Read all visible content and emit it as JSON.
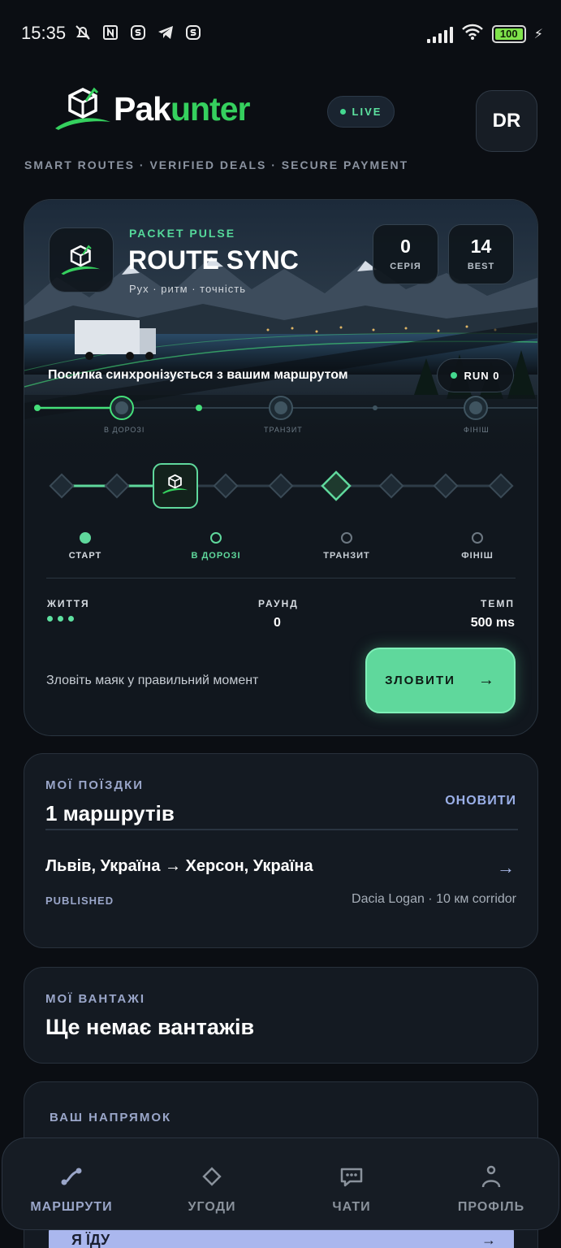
{
  "status_bar": {
    "time": "15:35",
    "battery": "100"
  },
  "header": {
    "brand_part1": "Pak",
    "brand_part2": "unter",
    "live_label": "LIVE",
    "avatar_initials": "DR",
    "tagline": "SMART ROUTES · VERIFIED DEALS · SECURE PAYMENT"
  },
  "game": {
    "kicker": "PACKET PULSE",
    "title": "ROUTE SYNC",
    "subtitle": "Рух · ритм · точність",
    "series_value": "0",
    "series_label": "СЕРІЯ",
    "best_value": "14",
    "best_label": "BEST",
    "sync_text": "Посилка синхронізується з вашим маршрутом",
    "run_label": "RUN 0",
    "scene_labels": [
      "В ДОРОЗІ",
      "ТРАНЗИТ",
      "ФІНІШ"
    ],
    "stages": [
      {
        "label": "СТАРТ",
        "state": "done"
      },
      {
        "label": "В ДОРОЗІ",
        "state": "active"
      },
      {
        "label": "ТРАНЗИТ",
        "state": "pending"
      },
      {
        "label": "ФІНІШ",
        "state": "pending"
      }
    ],
    "lives_label": "ЖИТТЯ",
    "lives_count": 3,
    "round_label": "РАУНД",
    "round_value": "0",
    "tempo_label": "ТЕМП",
    "tempo_value": "500 ms",
    "hint": "Зловіть маяк у правильний момент",
    "catch_label": "ЗЛОВИТИ",
    "catch_arrow": "→",
    "colors": {
      "accent": "#5fd89c",
      "accent_dark": "#35d05e"
    }
  },
  "trips": {
    "label": "МОЇ ПОЇЗДКИ",
    "title": "1 маршрутів",
    "refresh_label": "ОНОВИТИ",
    "items": [
      {
        "route": "Львів, Україна → Херсон, Україна",
        "status": "PUBLISHED",
        "vehicle": "Dacia Logan · 10 км corridor",
        "arrow": "→"
      }
    ]
  },
  "cargo": {
    "label": "МОЇ ВАНТАЖІ",
    "empty_text": "Ще немає вантажів"
  },
  "direction": {
    "label": "ВАШ НАПРЯМОК",
    "option_label": "Я ЇДУ",
    "option_arrow": "→"
  },
  "nav": {
    "items": [
      {
        "label": "МАРШРУТИ",
        "icon": "route-icon",
        "active": true
      },
      {
        "label": "УГОДИ",
        "icon": "diamond-icon",
        "active": false
      },
      {
        "label": "ЧАТИ",
        "icon": "chat-icon",
        "active": false
      },
      {
        "label": "ПРОФІЛЬ",
        "icon": "profile-icon",
        "active": false
      }
    ]
  }
}
